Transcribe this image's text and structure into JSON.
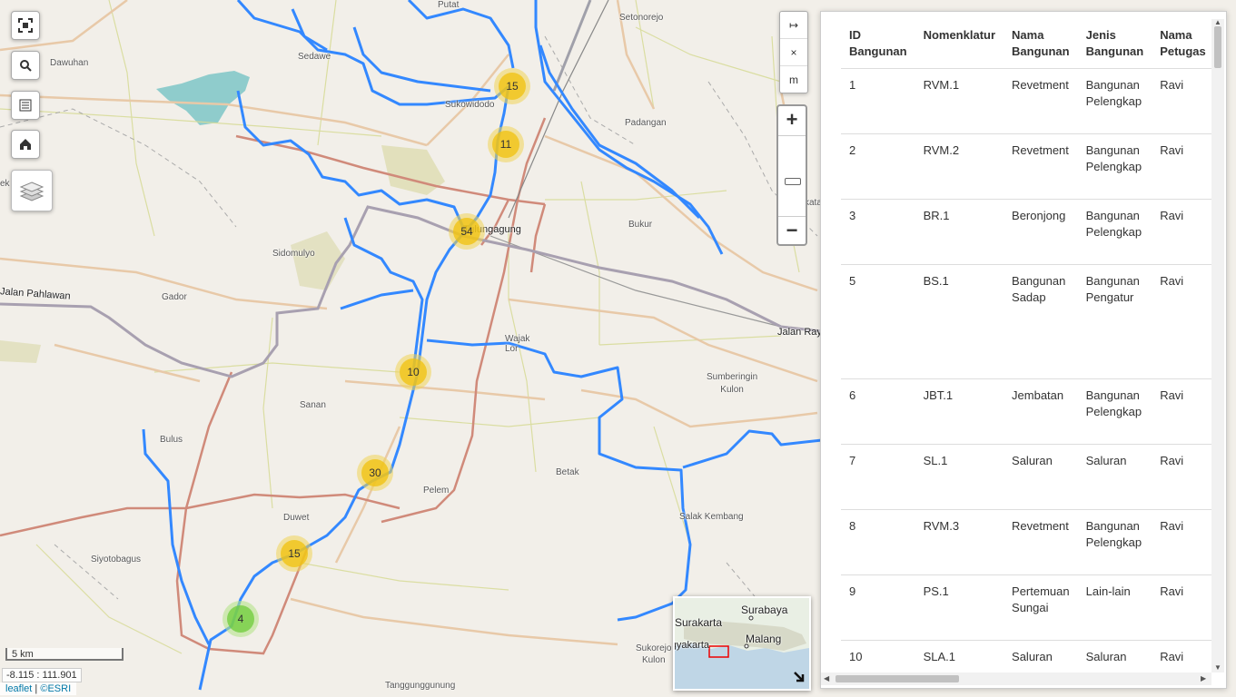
{
  "map": {
    "places": [
      {
        "id": "putat",
        "text": "Putat"
      },
      {
        "id": "setonorejo",
        "text": "Setonorejo"
      },
      {
        "id": "dawuhan",
        "text": "Dawuhan"
      },
      {
        "id": "sedawe",
        "text": "Sedawe"
      },
      {
        "id": "sukowidodo",
        "text": "Sukowidodo"
      },
      {
        "id": "padangan",
        "text": "Padangan"
      },
      {
        "id": "tulungagung",
        "text": "Tulungagung"
      },
      {
        "id": "bukur",
        "text": "Bukur"
      },
      {
        "id": "sidomulyo",
        "text": "Sidomulyo"
      },
      {
        "id": "gador",
        "text": "Gador"
      },
      {
        "id": "jalan_pahlawan",
        "text": "Jalan Pahlawan"
      },
      {
        "id": "wajak_lor",
        "text": "Wajak\nLor"
      },
      {
        "id": "jalan_raya",
        "text": "Jalan Raya"
      },
      {
        "id": "sumberingin",
        "text": "Sumberingin\nKulon"
      },
      {
        "id": "sanan",
        "text": "Sanan"
      },
      {
        "id": "bulus",
        "text": "Bulus"
      },
      {
        "id": "betak",
        "text": "Betak"
      },
      {
        "id": "pelem",
        "text": "Pelem"
      },
      {
        "id": "duwet",
        "text": "Duwet"
      },
      {
        "id": "salak_kembang",
        "text": "Salak Kembang"
      },
      {
        "id": "siyotobagus",
        "text": "Siyotobagus"
      },
      {
        "id": "sukorejo",
        "text": "Sukorejo\nKulon"
      },
      {
        "id": "tanggunggunung",
        "text": "Tanggunggunung"
      },
      {
        "id": "ek",
        "text": "ek"
      },
      {
        "id": "kata",
        "text": "kata"
      }
    ],
    "clusters": [
      {
        "count": "15",
        "size": "med"
      },
      {
        "count": "11",
        "size": "med"
      },
      {
        "count": "54",
        "size": "med"
      },
      {
        "count": "10",
        "size": "med"
      },
      {
        "count": "30",
        "size": "med"
      },
      {
        "count": "15",
        "size": "med"
      },
      {
        "count": "4",
        "size": "small"
      }
    ],
    "measure": {
      "expand": "↦",
      "clear": "×",
      "unit": "m"
    },
    "zoom": {
      "in": "+",
      "out": "−"
    },
    "minimap": {
      "labels": [
        "Surabaya",
        "Surakarta",
        "Malang",
        "Yogyakarta"
      ]
    },
    "scale": "5 km",
    "coords": "-8.115 : 111.901",
    "attribution": {
      "leaflet": "leaflet",
      "sep": " | ",
      "esri": "©ESRI"
    }
  },
  "table": {
    "headers": [
      "ID\nBangunan",
      "Nomenklatur",
      "Nama\nBangunan",
      "Jenis\nBangunan",
      "Nama\nPetugas"
    ],
    "rows": [
      [
        "1",
        "RVM.1",
        "Revetment",
        "Bangunan\nPelengkap",
        "Ravi"
      ],
      [
        "2",
        "RVM.2",
        "Revetment",
        "Bangunan\nPelengkap",
        "Ravi"
      ],
      [
        "3",
        "BR.1",
        "Beronjong",
        "Bangunan\nPelengkap",
        "Ravi"
      ],
      [
        "5",
        "BS.1",
        "Bangunan\nSadap",
        "Bangunan\nPengatur",
        "Ravi"
      ],
      [
        "6",
        "JBT.1",
        "Jembatan",
        "Bangunan\nPelengkap",
        "Ravi"
      ],
      [
        "7",
        "SL.1",
        "Saluran",
        "Saluran",
        "Ravi"
      ],
      [
        "8",
        "RVM.3",
        "Revetment",
        "Bangunan\nPelengkap",
        "Ravi"
      ],
      [
        "9",
        "PS.1",
        "Pertemuan\nSungai",
        "Lain-lain",
        "Ravi"
      ],
      [
        "10",
        "SLA.1",
        "Saluran",
        "Saluran",
        "Ravi"
      ]
    ]
  },
  "colors": {
    "river": "#3388ff",
    "cluster_medium": "#f0c20c",
    "cluster_small": "#6ecc39",
    "road_primary": "#d08070",
    "road_secondary": "#e8c9a8"
  }
}
